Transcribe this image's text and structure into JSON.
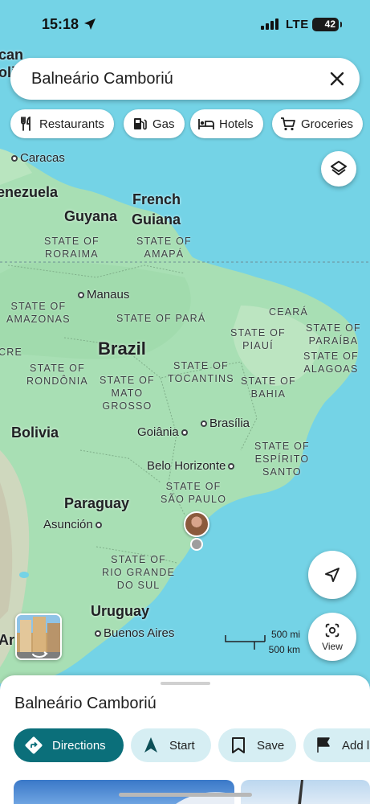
{
  "status_bar": {
    "time": "15:18",
    "network": "LTE",
    "battery": "42"
  },
  "search": {
    "query": "Balneário Camboriú"
  },
  "chips": [
    {
      "label": "Restaurants",
      "icon": "restaurant-icon"
    },
    {
      "label": "Gas",
      "icon": "gas-station-icon"
    },
    {
      "label": "Hotels",
      "icon": "hotel-bed-icon"
    },
    {
      "label": "Groceries",
      "icon": "shopping-cart-icon"
    }
  ],
  "map": {
    "partial_labels": {
      "top_left_1": "can",
      "top_left_2": "oli",
      "venezuela": "enezuela",
      "cre": "CRE",
      "argentina": "Ar"
    },
    "countries": {
      "french_guiana_1": "French",
      "french_guiana_2": "Guiana",
      "guyana": "Guyana",
      "brazil": "Brazil",
      "bolivia": "Bolivia",
      "paraguay": "Paraguay",
      "uruguay": "Uruguay",
      "argentina_suffix": "a"
    },
    "states": {
      "roraima_1": "STATE OF",
      "roraima_2": "RORAIMA",
      "amapa_1": "STATE OF",
      "amapa_2": "AMAPÁ",
      "amazonas_1": "STATE OF",
      "amazonas_2": "AMAZONAS",
      "para": "STATE OF PARÁ",
      "ceara": "CEARÁ",
      "piaui_1": "STATE OF",
      "piaui_2": "PIAUÍ",
      "paraiba_1": "STATE OF",
      "paraiba_2": "PARAÍBA",
      "alagoas_1": "STATE OF",
      "alagoas_2": "ALAGOAS",
      "rondonia_1": "STATE OF",
      "rondonia_2": "RONDÔNIA",
      "mato_grosso_1": "STATE OF",
      "mato_grosso_2": "MATO",
      "mato_grosso_3": "GROSSO",
      "tocantins_1": "STATE OF",
      "tocantins_2": "TOCANTINS",
      "bahia_1": "STATE OF",
      "bahia_2": "BAHIA",
      "espirito_santo_1": "STATE OF",
      "espirito_santo_2": "ESPÍRITO",
      "espirito_santo_3": "SANTO",
      "sao_paulo_1": "STATE OF",
      "sao_paulo_2": "SÃO PAULO",
      "rio_grande_1": "STATE OF",
      "rio_grande_2": "RIO GRANDE",
      "rio_grande_3": "DO SUL"
    },
    "cities": {
      "caracas": "Caracas",
      "manaus": "Manaus",
      "brasilia": "Brasília",
      "goiania": "Goiânia",
      "belo_horizonte": "Belo Horizonte",
      "asuncion": "Asunción",
      "buenos_aires": "Buenos Aires"
    },
    "scale": {
      "miles": "500 mi",
      "km": "500 km"
    },
    "view_label": "View"
  },
  "place_sheet": {
    "title": "Balneário Camboriú",
    "actions": [
      {
        "label": "Directions",
        "icon": "directions-icon"
      },
      {
        "label": "Start",
        "icon": "navigation-arrow-icon"
      },
      {
        "label": "Save",
        "icon": "bookmark-icon"
      },
      {
        "label": "Add l",
        "icon": "flag-icon"
      }
    ]
  },
  "colors": {
    "water": "#74d3e6",
    "land": "#a8dfb4",
    "accent": "#0b6f7a",
    "chip_bg": "#d6eef3"
  }
}
